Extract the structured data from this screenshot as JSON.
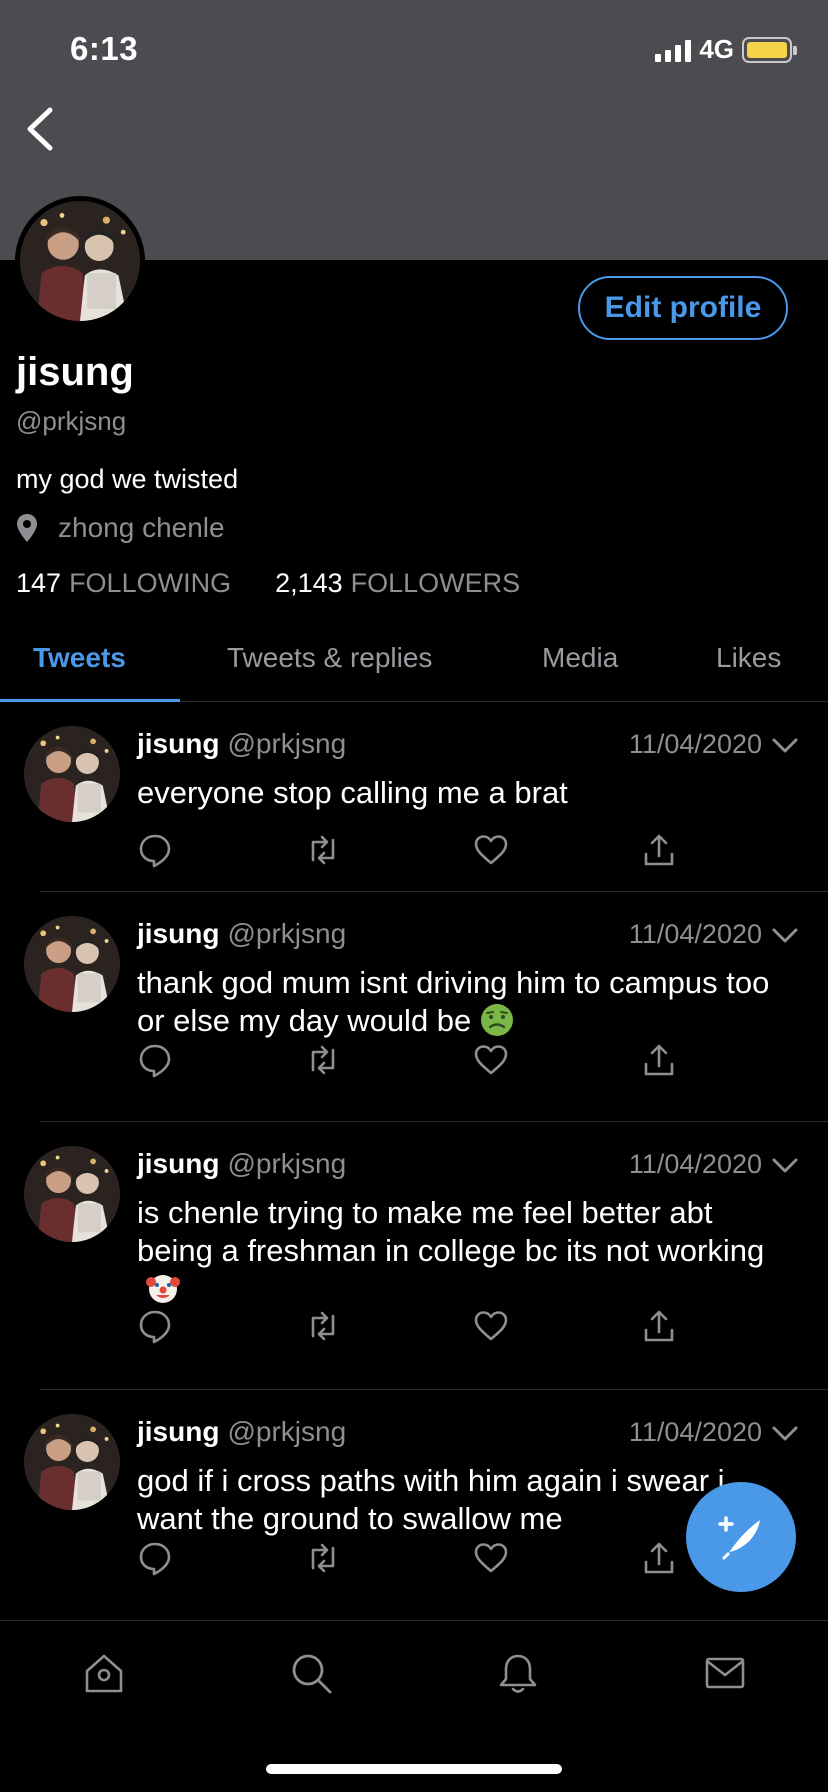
{
  "status_bar": {
    "time": "6:13",
    "network": "4G"
  },
  "profile": {
    "display_name": "jisung",
    "handle": "@prkjsng",
    "bio": "my god we twisted",
    "location": "zhong chenle",
    "following_count": "147",
    "following_label": "FOLLOWING",
    "followers_count": "2,143",
    "followers_label": "FOLLOWERS",
    "edit_button": "Edit profile"
  },
  "tabs": [
    {
      "label": "Tweets",
      "active": true
    },
    {
      "label": "Tweets & replies",
      "active": false
    },
    {
      "label": "Media",
      "active": false
    },
    {
      "label": "Likes",
      "active": false
    }
  ],
  "tweets": [
    {
      "name": "jisung",
      "handle": "@prkjsng",
      "date": "11/04/2020",
      "text": "everyone stop calling me a brat",
      "emoji": ""
    },
    {
      "name": "jisung",
      "handle": "@prkjsng",
      "date": "11/04/2020",
      "text": "thank god mum isnt driving him to campus too or else my day would be",
      "emoji": "nauseated-face"
    },
    {
      "name": "jisung",
      "handle": "@prkjsng",
      "date": "11/04/2020",
      "text": "is chenle trying to make me feel better abt being a freshman in college bc its not working",
      "emoji": "clown-face"
    },
    {
      "name": "jisung",
      "handle": "@prkjsng",
      "date": "11/04/2020",
      "text": "god if i cross paths with him again i swear i want the ground to swallow me",
      "emoji": ""
    }
  ],
  "bottom_nav": [
    "home-icon",
    "search-icon",
    "bell-icon",
    "mail-icon"
  ],
  "colors": {
    "accent": "#4a99e9",
    "banner": "#4b4b50",
    "background": "#000000",
    "secondary_text": "#8e8e93"
  }
}
